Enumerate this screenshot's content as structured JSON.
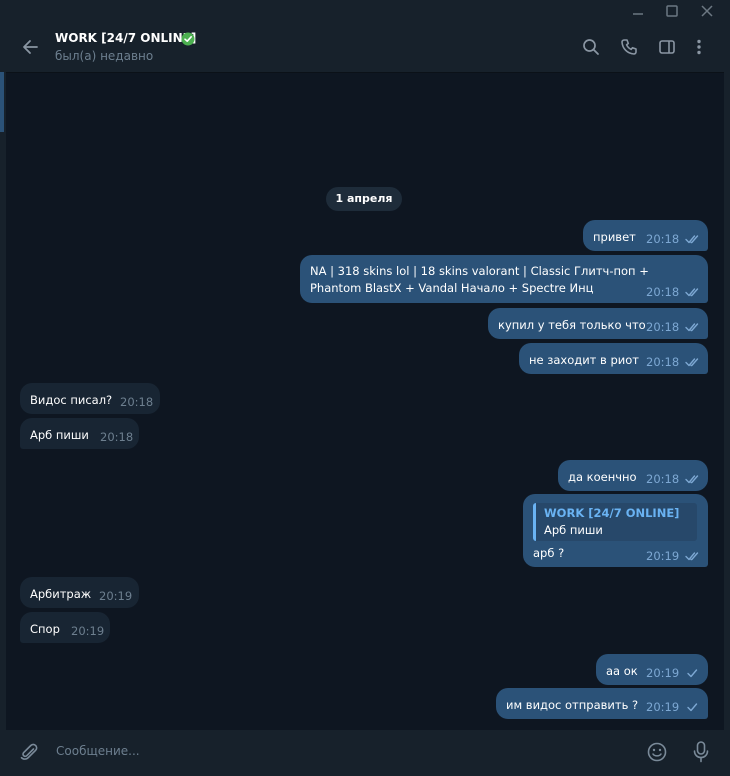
{
  "window": {
    "controls": [
      "minimize-icon",
      "maximize-icon",
      "close-icon"
    ]
  },
  "header": {
    "title": "WORK [24/7 ONLINE]",
    "status": "был(а) недавно",
    "verified": true,
    "icons": [
      "search-icon",
      "phone-icon",
      "sidebar-toggle-icon",
      "more-vertical-icon"
    ]
  },
  "colors": {
    "background": "#0e1621",
    "panel": "#17212b",
    "outgoing_bubble": "#2b5278",
    "incoming_bubble": "#182533",
    "accent": "#6ab3f3",
    "verified_green": "#4caf50"
  },
  "chat": {
    "date": "1 апреля",
    "messages": [
      {
        "dir": "out",
        "text": "привет",
        "time": "20:18",
        "read": true
      },
      {
        "dir": "out",
        "text": "NA | 318 skins lol | 18 skins valorant | Classic Глитч-поп + Phantom BlastX + Vandal Начало + Spectre Инц",
        "time": "20:18",
        "read": true
      },
      {
        "dir": "out",
        "text": "купил у тебя только что",
        "time": "20:18",
        "read": true
      },
      {
        "dir": "out",
        "text": "не заходит в риот",
        "time": "20:18",
        "read": true
      },
      {
        "dir": "in",
        "text": "Видос писал?",
        "time": "20:18"
      },
      {
        "dir": "in",
        "text": "Арб пиши",
        "time": "20:18"
      },
      {
        "dir": "out",
        "text": "да коенчно",
        "time": "20:18",
        "read": true
      },
      {
        "dir": "out",
        "text": "арб ?",
        "time": "20:19",
        "read": true,
        "reply_to": {
          "author": "WORK [24/7 ONLINE]",
          "text": "Арб пиши"
        }
      },
      {
        "dir": "in",
        "text": "Арбитраж",
        "time": "20:19"
      },
      {
        "dir": "in",
        "text": "Спор",
        "time": "20:19"
      },
      {
        "dir": "out",
        "text": "аа ок",
        "time": "20:19",
        "read": false
      },
      {
        "dir": "out",
        "text": "им видос отправить ?",
        "time": "20:19",
        "read": false
      }
    ]
  },
  "composer": {
    "placeholder": "Сообщение...",
    "icons": [
      "attach-icon",
      "emoji-icon",
      "microphone-icon"
    ]
  }
}
